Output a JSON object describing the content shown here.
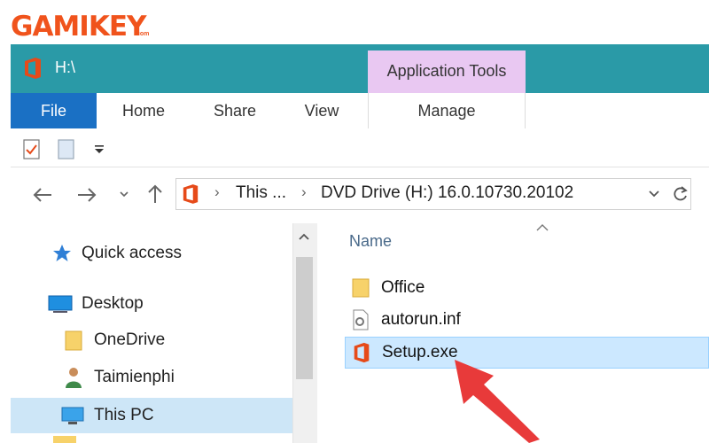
{
  "watermark": {
    "brand": "GAMIKEY",
    "suffix": ".com"
  },
  "window": {
    "title": "H:\\"
  },
  "ribbon": {
    "context_group": "Application Tools",
    "tabs": [
      "File",
      "Home",
      "Share",
      "View"
    ],
    "context_tab": "Manage"
  },
  "address": {
    "crumbs": [
      "This ...",
      "DVD Drive (H:) 16.0.10730.20102"
    ]
  },
  "nav_pane": {
    "items": [
      {
        "label": "Quick access",
        "icon": "star-pin-icon"
      },
      {
        "label": "Desktop",
        "icon": "desktop-icon"
      },
      {
        "label": "OneDrive",
        "icon": "folder-icon"
      },
      {
        "label": "Taimienphi",
        "icon": "user-icon"
      },
      {
        "label": "This PC",
        "icon": "computer-icon",
        "selected": true
      }
    ]
  },
  "content": {
    "column_header": "Name",
    "files": [
      {
        "name": "Office",
        "icon": "folder-icon"
      },
      {
        "name": "autorun.inf",
        "icon": "settings-file-icon"
      },
      {
        "name": "Setup.exe",
        "icon": "office-icon",
        "selected": true
      }
    ]
  },
  "colors": {
    "titlebar": "#2a9aa7",
    "file_tab": "#1a70c4",
    "context_header": "#e9c8f2",
    "selection": "#cce8ff",
    "office_orange": "#e64a19",
    "annotation_arrow": "#e83a3a",
    "brand": "#f0531c"
  }
}
